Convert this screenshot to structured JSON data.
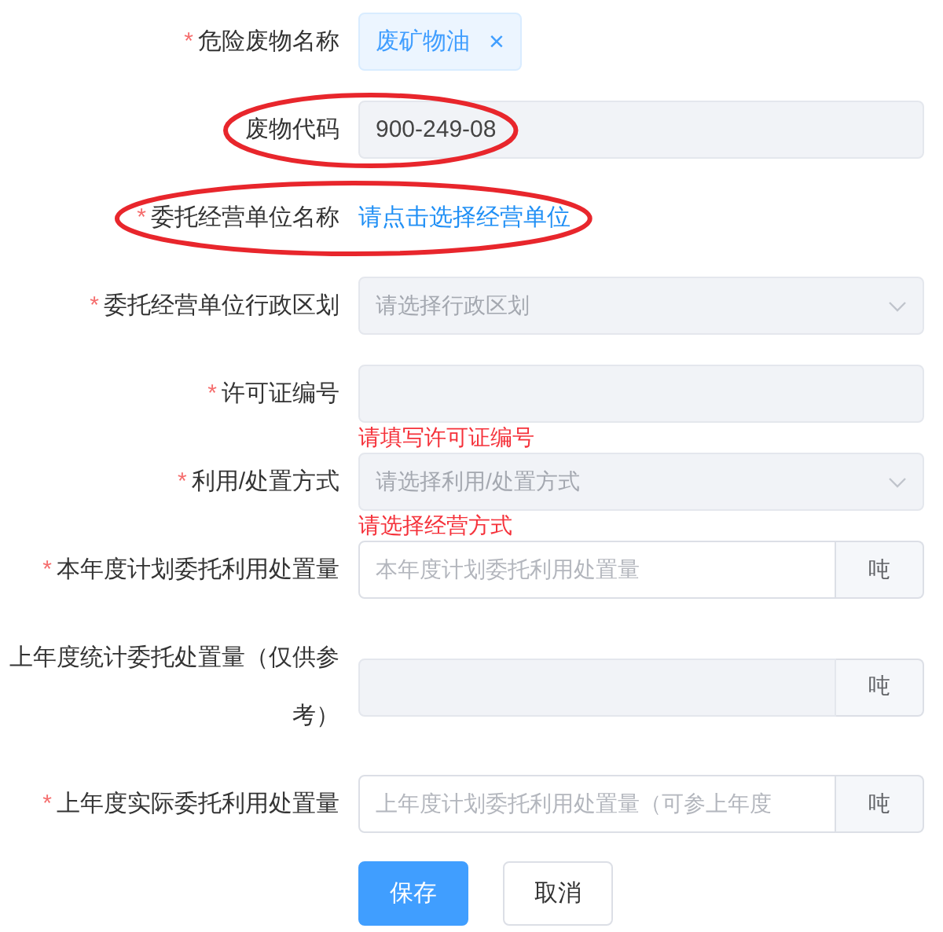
{
  "required_mark": "*",
  "fields": [
    {
      "label": "危险废物名称",
      "required": true,
      "kind": "tag",
      "tag": "废矿物油",
      "remove": "×",
      "highlighted": false
    },
    {
      "label": "废物代码",
      "required": false,
      "kind": "input",
      "disabled": true,
      "value": "900-249-08",
      "highlighted": true
    },
    {
      "label": "委托经营单位名称",
      "required": true,
      "kind": "link",
      "link": "请点击选择经营单位",
      "highlighted": true
    },
    {
      "label": "委托经营单位行政区划",
      "required": true,
      "kind": "select",
      "disabled": true,
      "placeholder": "请选择行政区划",
      "highlighted": false
    },
    {
      "label": "许可证编号",
      "required": true,
      "kind": "input",
      "disabled": true,
      "error": "请填写许可证编号",
      "highlighted": false
    },
    {
      "label": "利用/处置方式",
      "required": true,
      "kind": "select",
      "disabled": true,
      "placeholder": "请选择利用/处置方式",
      "error": "请选择经营方式",
      "highlighted": false
    },
    {
      "label": "本年度计划委托利用处置量",
      "required": true,
      "kind": "input",
      "disabled": false,
      "placeholder": "本年度计划委托利用处置量",
      "unit": "吨",
      "highlighted": false
    },
    {
      "label": "上年度统计委托处置量（仅供参考）",
      "required": false,
      "kind": "input",
      "disabled": true,
      "unit": "吨",
      "highlighted": false
    },
    {
      "label": "上年度实际委托利用处置量",
      "required": true,
      "kind": "input",
      "disabled": false,
      "placeholder": "上年度计划委托利用处置量（可参上年度",
      "unit": "吨",
      "highlighted": false
    }
  ],
  "buttons": [
    {
      "label": "保存",
      "primary": true
    },
    {
      "label": "取消",
      "primary": false
    }
  ]
}
